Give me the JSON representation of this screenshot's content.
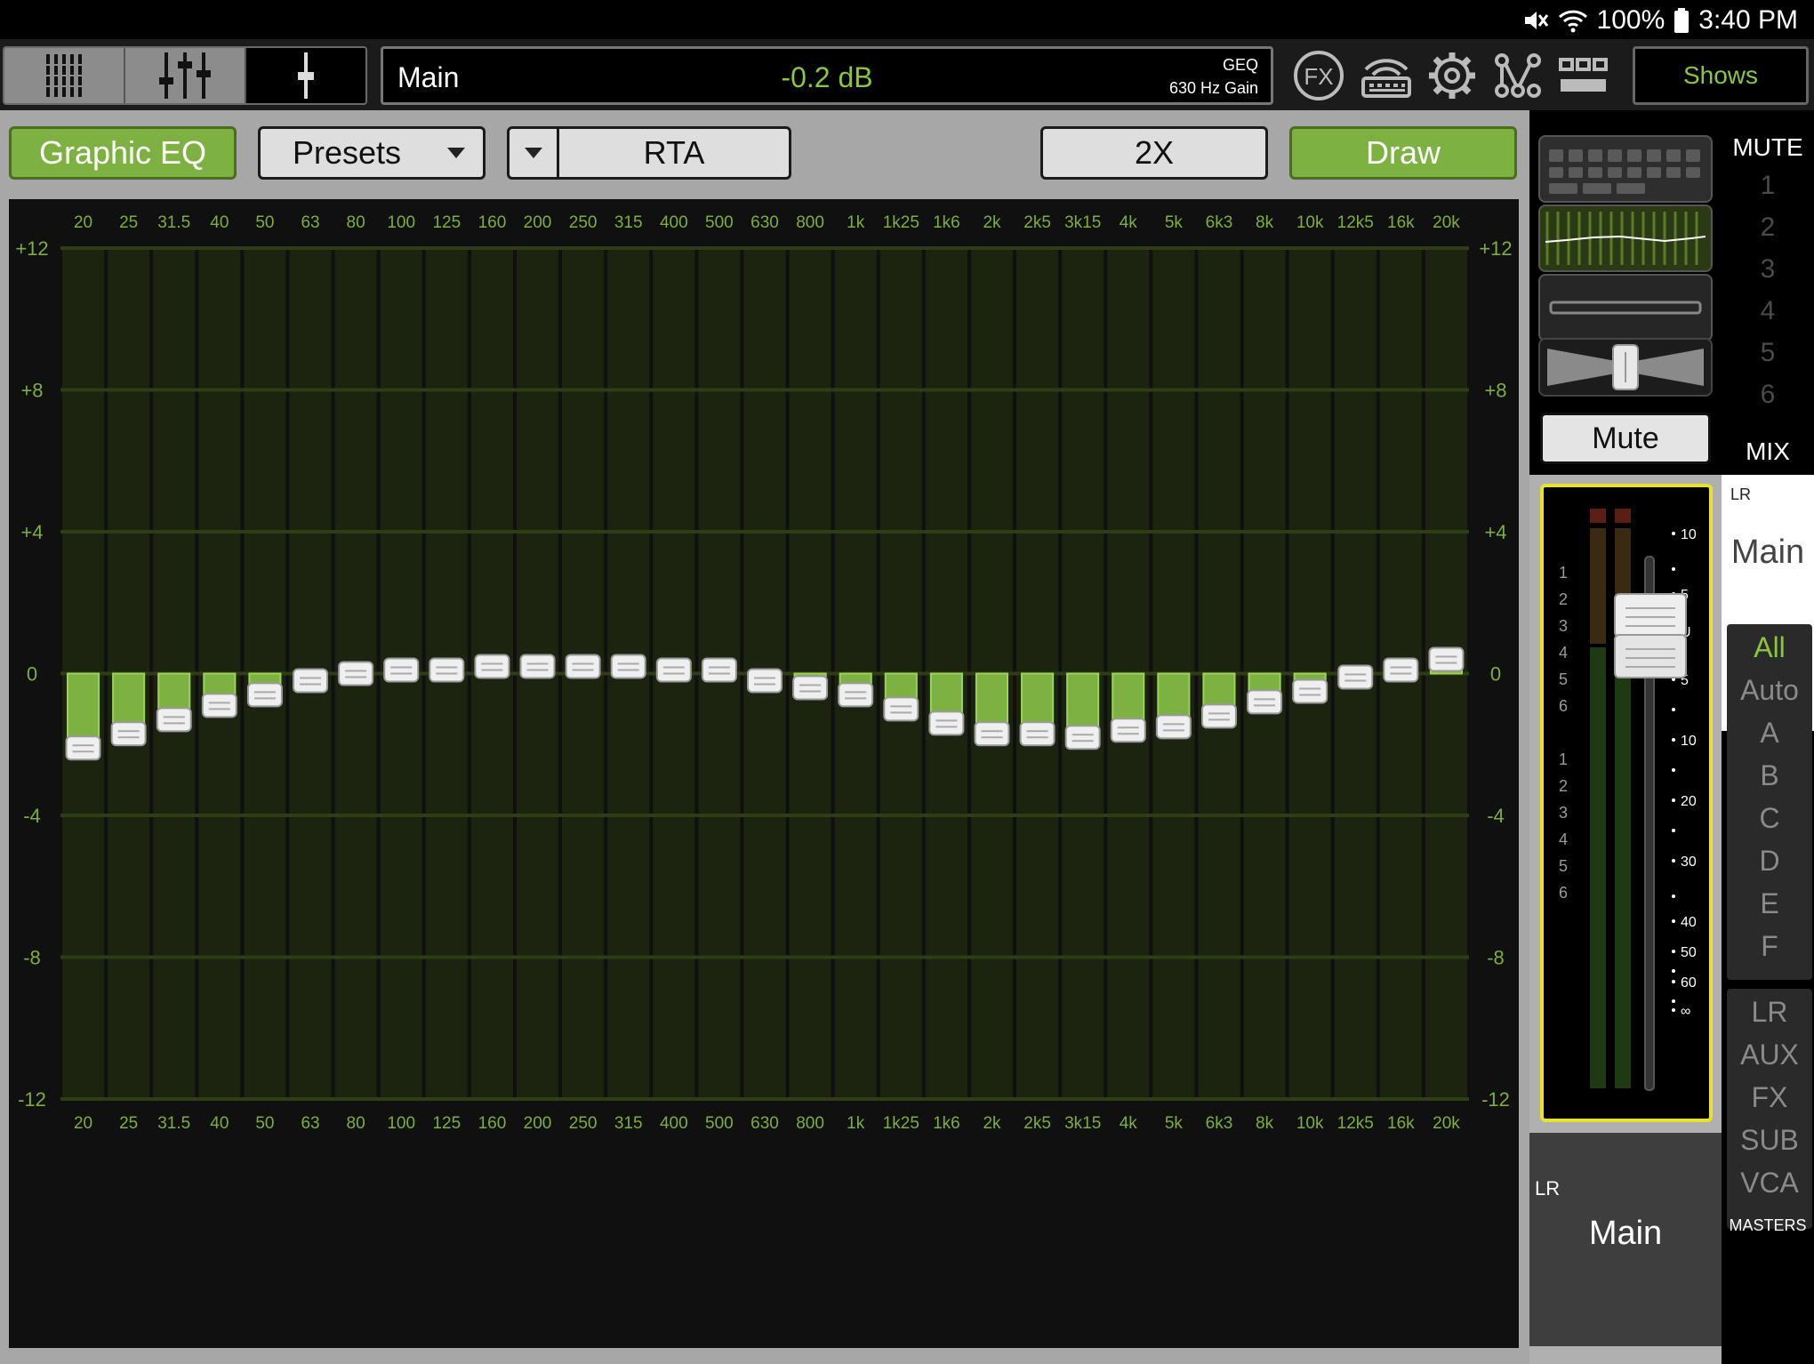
{
  "status_bar": {
    "battery": "100%",
    "time": "3:40 PM"
  },
  "header": {
    "channel_name": "Main",
    "value": "-0.2 dB",
    "param_line1": "GEQ",
    "param_line2": "630 Hz Gain",
    "shows_label": "Shows",
    "fx_label": "FX"
  },
  "toolbar": {
    "graphic_eq_label": "Graphic EQ",
    "presets_label": "Presets",
    "rta_label": "RTA",
    "zoom_label": "2X",
    "draw_label": "Draw"
  },
  "chart_data": {
    "type": "bar",
    "categories": [
      "20",
      "25",
      "31.5",
      "40",
      "50",
      "63",
      "80",
      "100",
      "125",
      "160",
      "200",
      "250",
      "315",
      "400",
      "500",
      "630",
      "800",
      "1k",
      "1k25",
      "1k6",
      "2k",
      "2k5",
      "3k15",
      "4k",
      "5k",
      "6k3",
      "8k",
      "10k",
      "12k5",
      "16k",
      "20k"
    ],
    "values": [
      -2.1,
      -1.7,
      -1.3,
      -0.9,
      -0.6,
      -0.2,
      0.0,
      0.1,
      0.1,
      0.2,
      0.2,
      0.2,
      0.2,
      0.1,
      0.1,
      -0.2,
      -0.4,
      -0.6,
      -1.0,
      -1.4,
      -1.7,
      -1.7,
      -1.8,
      -1.6,
      -1.5,
      -1.2,
      -0.8,
      -0.5,
      -0.1,
      0.1,
      0.4
    ],
    "y_ticks": [
      "+12",
      "+8",
      "+4",
      "0",
      "-4",
      "-8",
      "-12"
    ],
    "ylim": [
      -12,
      12
    ],
    "grid": true
  },
  "strip": {
    "mute_label": "Mute",
    "meter_numbers_a": [
      "1",
      "2",
      "3",
      "4",
      "5",
      "6"
    ],
    "meter_numbers_b": [
      "1",
      "2",
      "3",
      "4",
      "5",
      "6"
    ],
    "fader_scale": [
      "10",
      "5",
      "U",
      "5",
      "10",
      "20",
      "30",
      "40",
      "50",
      "60",
      "∞"
    ],
    "bottom_bus": "LR",
    "bottom_name": "Main"
  },
  "side": {
    "mute_header": "MUTE",
    "mute_groups": [
      "1",
      "2",
      "3",
      "4",
      "5",
      "6"
    ],
    "mix_header": "MIX",
    "mix_bus": "LR",
    "mix_name": "Main",
    "groups": [
      "All",
      "Auto",
      "A",
      "B",
      "C",
      "D",
      "E",
      "F"
    ],
    "masters": [
      "LR",
      "AUX",
      "FX",
      "SUB",
      "VCA"
    ],
    "masters_label": "MASTERS"
  },
  "colors": {
    "accent_green": "#8cc63f",
    "bar_green": "#7db243",
    "fader_highlight": "#e7e22b"
  }
}
